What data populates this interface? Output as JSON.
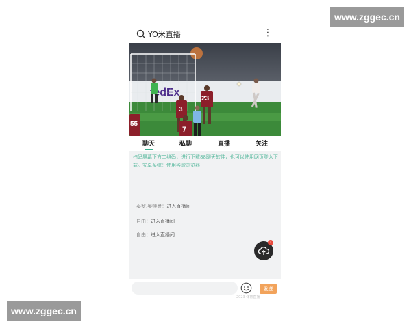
{
  "watermark": {
    "text": "www.zggec.cn"
  },
  "header": {
    "title": "YO米直播",
    "search_icon": "search-icon",
    "more_icon": "more-vertical-icon"
  },
  "video": {
    "jerseys": [
      "55",
      "3",
      "23",
      "7"
    ],
    "ad_text": "fedEx"
  },
  "tabs": [
    {
      "label": "聊天",
      "active": true
    },
    {
      "label": "私聊",
      "active": false
    },
    {
      "label": "直播",
      "active": false
    },
    {
      "label": "关注",
      "active": false
    }
  ],
  "chat": {
    "notice": "扫码屏幕下方二维码，进行下载88聊天软件，也可以使用网页登入下载。安卓系统：使用谷歌浏览器",
    "messages": [
      {
        "user": "泰罗.奥特曼：",
        "text": "进入直播间"
      },
      {
        "user": "自由：",
        "text": "进入直播间"
      },
      {
        "user": "自由：",
        "text": "进入直播间"
      }
    ],
    "badge_count": "1"
  },
  "input": {
    "placeholder": "",
    "send_label": "发送",
    "faint_text": "2023 体育直播"
  },
  "colors": {
    "accent": "#3bb08f",
    "send": "#f2a35b",
    "fab": "#2a2a2a"
  }
}
